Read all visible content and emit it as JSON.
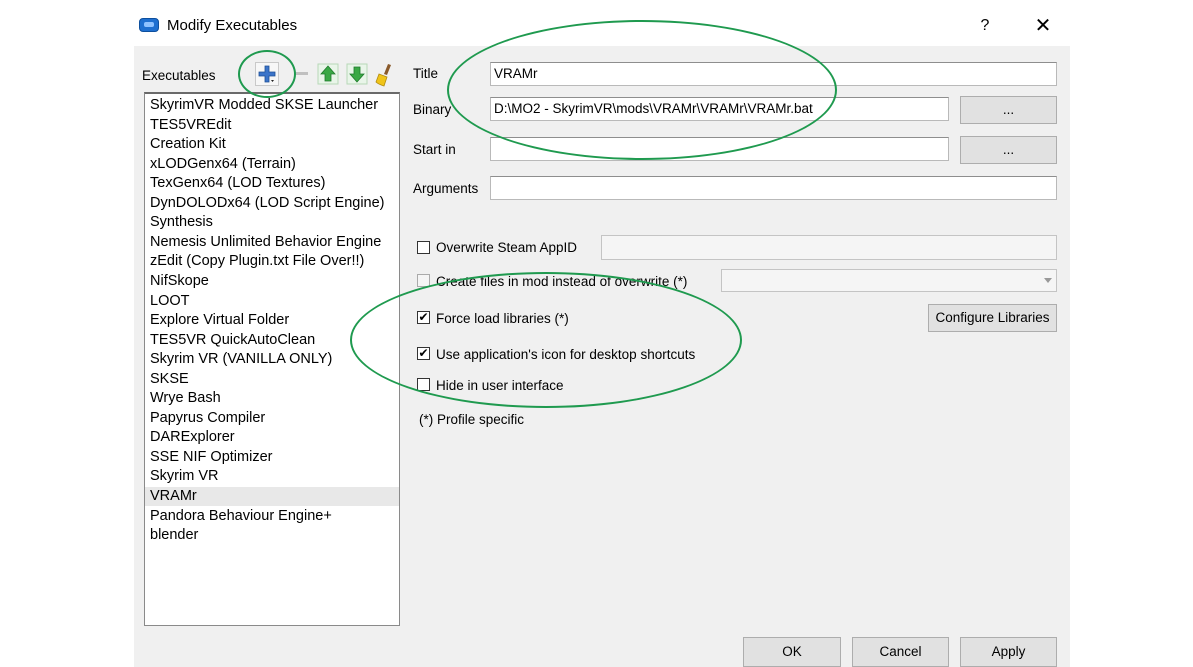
{
  "window": {
    "title": "Modify Executables",
    "help_label": "?",
    "close_label": "✕"
  },
  "executables": {
    "label": "Executables",
    "items": [
      "SkyrimVR Modded SKSE Launcher",
      "TES5VREdit",
      "Creation Kit",
      "xLODGenx64 (Terrain)",
      "TexGenx64 (LOD Textures)",
      "DynDOLODx64 (LOD Script Engine)",
      "Synthesis",
      "Nemesis Unlimited Behavior Engine",
      "zEdit (Copy Plugin.txt File Over!!)",
      "NifSkope",
      "LOOT",
      "Explore Virtual Folder",
      "TES5VR QuickAutoClean",
      "Skyrim VR (VANILLA ONLY)",
      "SKSE",
      "Wrye Bash",
      "Papyrus Compiler",
      "DARExplorer",
      "SSE NIF Optimizer",
      "Skyrim VR",
      "VRAMr",
      "Pandora Behaviour Engine+",
      "blender"
    ],
    "selected": "VRAMr",
    "toolbar_icons": [
      "add-icon",
      "remove-icon",
      "move-up-icon",
      "move-down-icon",
      "clean-icon"
    ]
  },
  "form": {
    "title_label": "Title",
    "title_value": "VRAMr",
    "binary_label": "Binary",
    "binary_value": "D:\\MO2 - SkyrimVR\\mods\\VRAMr\\VRAMr\\VRAMr.bat",
    "startin_label": "Start in",
    "startin_value": "",
    "arguments_label": "Arguments",
    "arguments_value": "",
    "browse_label": "...",
    "overwrite_appid_label": "Overwrite Steam AppID",
    "create_files_label": "Create files in mod instead of overwrite (*)",
    "force_load_label": "Force load libraries (*)",
    "configure_libraries_label": "Configure Libraries",
    "use_icon_label": "Use application's icon for desktop shortcuts",
    "hide_label": "Hide in user interface",
    "profile_note": "(*) Profile specific",
    "checks": {
      "overwrite_appid": "",
      "create_files": "",
      "force_load": "✔",
      "use_icon": "✔",
      "hide": ""
    }
  },
  "buttons": {
    "ok": "OK",
    "cancel": "Cancel",
    "apply": "Apply"
  },
  "colors": {
    "highlight_ring": "#1f9a4f",
    "arrow_green": "#3aa845",
    "add_icon_blue": "#3b74c9"
  }
}
